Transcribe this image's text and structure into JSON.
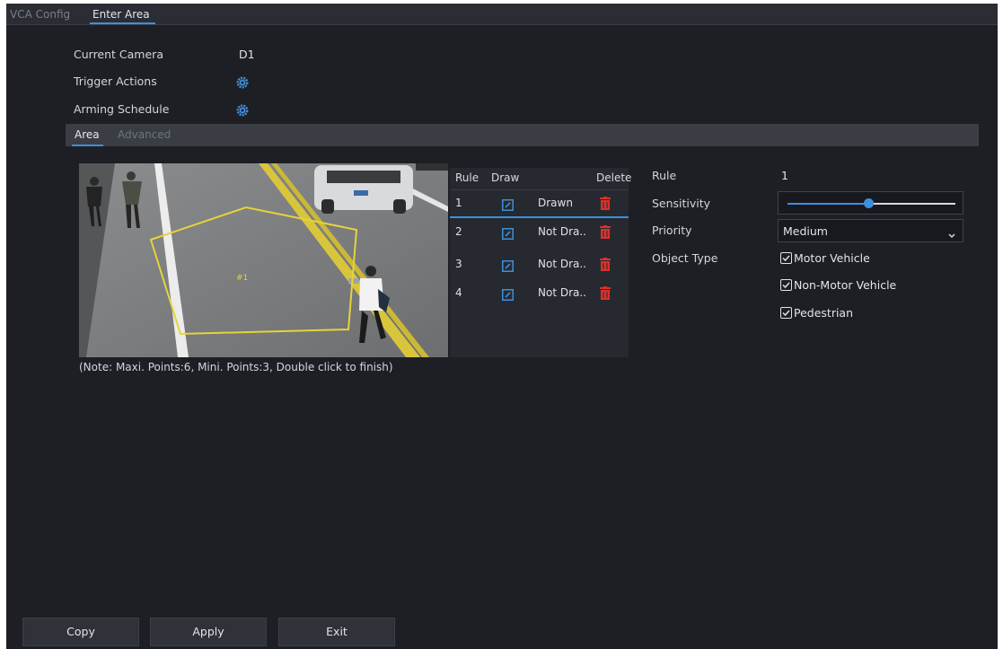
{
  "tabs": {
    "vca_config": "VCA Config",
    "enter_area": "Enter Area"
  },
  "info": {
    "current_camera_label": "Current Camera",
    "current_camera_value": "D1",
    "trigger_actions_label": "Trigger Actions",
    "arming_schedule_label": "Arming Schedule"
  },
  "subtabs": {
    "area": "Area",
    "advanced": "Advanced"
  },
  "video": {
    "area_marker": "#1"
  },
  "note": "(Note: Maxi. Points:6, Mini. Points:3, Double click to finish)",
  "rules_table": {
    "headers": {
      "rule": "Rule",
      "draw": "Draw",
      "delete": "Delete"
    },
    "rows": [
      {
        "rule": "1",
        "status": "Drawn"
      },
      {
        "rule": "2",
        "status": "Not Dra.."
      },
      {
        "rule": "3",
        "status": "Not Dra.."
      },
      {
        "rule": "4",
        "status": "Not Dra.."
      }
    ]
  },
  "settings": {
    "rule_label": "Rule",
    "rule_value": "1",
    "sensitivity_label": "Sensitivity",
    "sensitivity_level": 0.48,
    "priority_label": "Priority",
    "priority_value": "Medium",
    "object_type_label": "Object Type",
    "object_types": [
      {
        "label": "Motor Vehicle",
        "checked": true
      },
      {
        "label": "Non-Motor Vehicle",
        "checked": true
      },
      {
        "label": "Pedestrian",
        "checked": true
      }
    ]
  },
  "buttons": {
    "copy": "Copy",
    "apply": "Apply",
    "exit": "Exit"
  },
  "colors": {
    "accent": "#3e8fdc",
    "delete": "#d9322a",
    "polygon": "#e6d33a",
    "background": "#1d1f25"
  },
  "icons": {
    "gear": "gear-icon",
    "draw": "edit-icon",
    "delete": "trash-icon",
    "dropdown": "chevron-down-icon",
    "check": "check-icon"
  }
}
